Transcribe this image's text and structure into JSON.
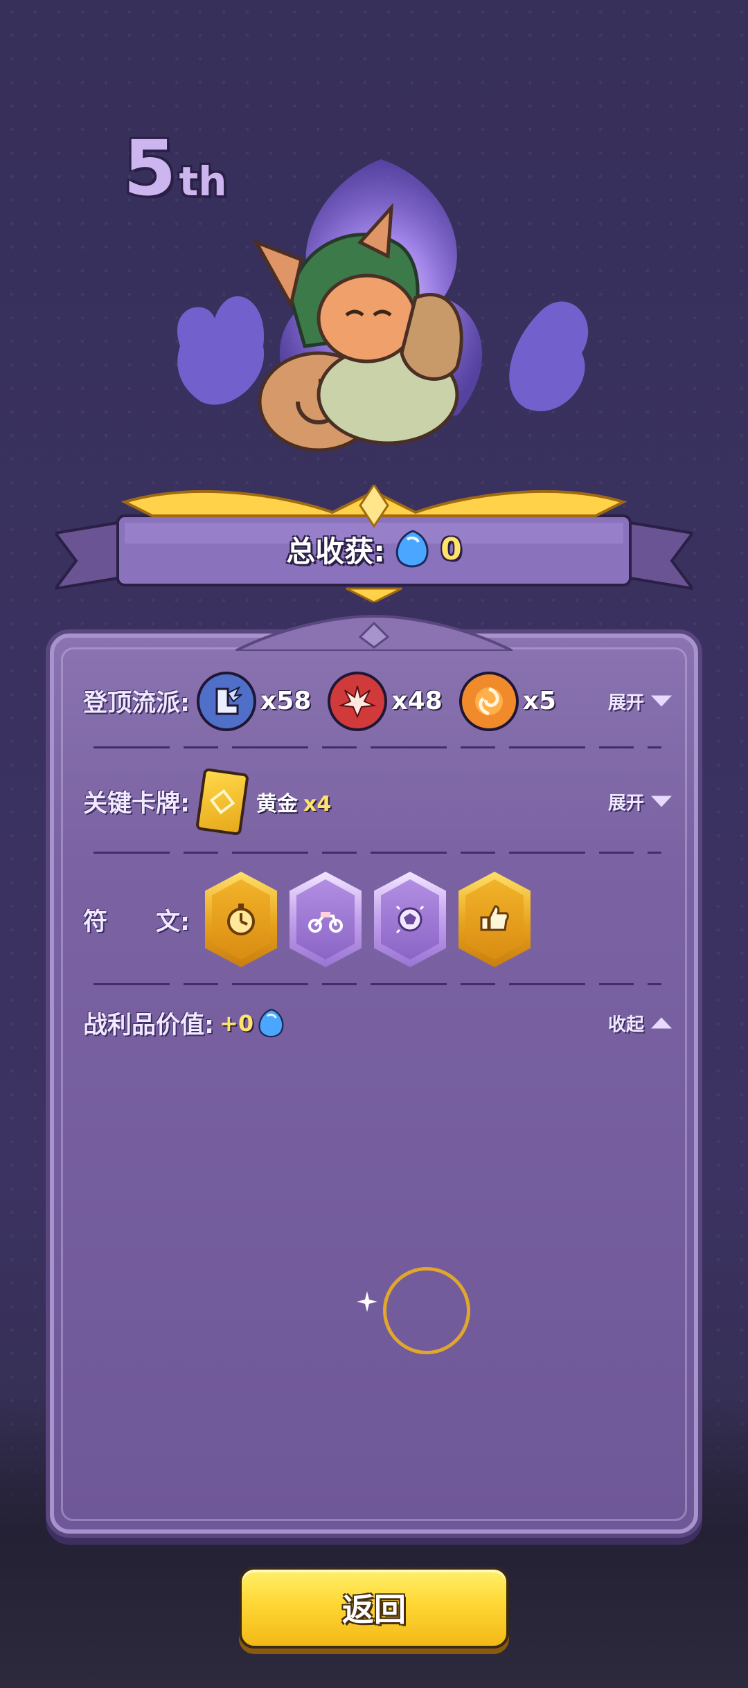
{
  "rank": {
    "number": "5",
    "suffix": "th"
  },
  "header": {
    "total_label": "总收获:",
    "total_value": "0"
  },
  "rows": {
    "sect": {
      "label": "登顶流派:",
      "toggle": "展开",
      "items": [
        {
          "icon": "boot-wing-icon",
          "count": "x58",
          "color": "#4f6fc8"
        },
        {
          "icon": "burst-icon",
          "count": "x48",
          "color": "#d03a3a"
        },
        {
          "icon": "flame-swirl-icon",
          "count": "x5",
          "color": "#f08a2a"
        }
      ]
    },
    "card": {
      "label": "关键卡牌:",
      "toggle": "展开",
      "name": "黄金",
      "count": "x4"
    },
    "runes": {
      "label": "符　　文:",
      "items": [
        {
          "icon": "stopwatch-rune-icon",
          "tier": "gold"
        },
        {
          "icon": "motorcycle-rune-icon",
          "tier": "purple"
        },
        {
          "icon": "orb-rune-icon",
          "tier": "purple"
        },
        {
          "icon": "thumbs-up-rune-icon",
          "tier": "gold"
        }
      ]
    },
    "loot": {
      "label": "战利品价值:",
      "value": "+0",
      "toggle": "收起"
    }
  },
  "footer": {
    "back_label": "返回"
  },
  "colors": {
    "accent_gold": "#ffd735",
    "panel": "#7b63a3",
    "value_yellow": "#ffe36b"
  }
}
